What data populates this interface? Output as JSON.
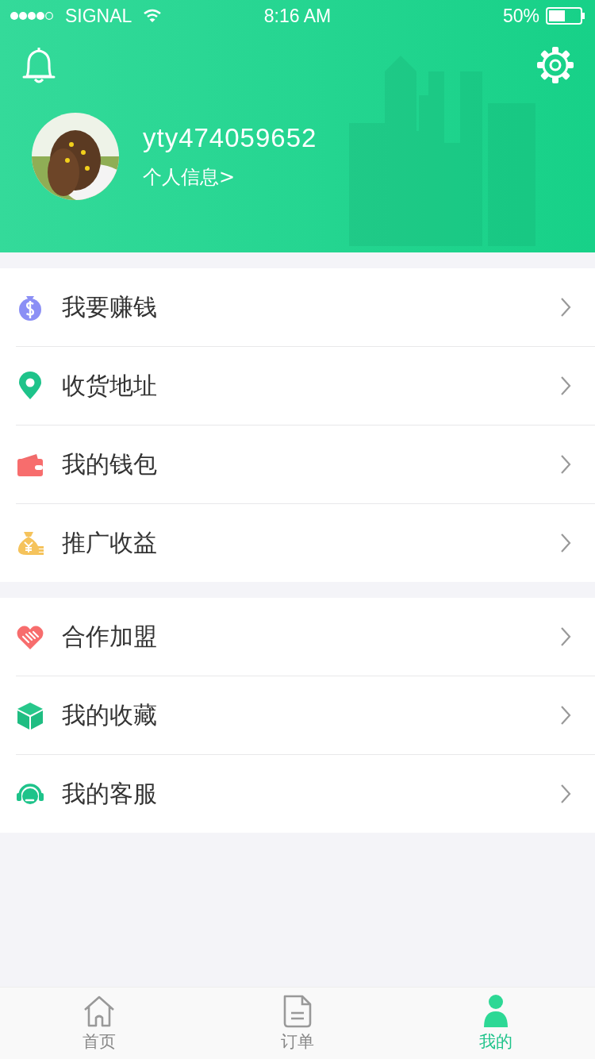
{
  "status_bar": {
    "carrier": "SIGNAL",
    "time": "8:16 AM",
    "battery": "50%"
  },
  "profile": {
    "username": "yty474059652",
    "link": "个人信息>"
  },
  "menu_groups": [
    {
      "items": [
        {
          "kind": "money",
          "label": "我要赚钱"
        },
        {
          "kind": "pin",
          "label": "收货地址"
        },
        {
          "kind": "wallet",
          "label": "我的钱包"
        },
        {
          "kind": "yen",
          "label": "推广收益"
        }
      ]
    },
    {
      "items": [
        {
          "kind": "handshake",
          "label": "合作加盟"
        },
        {
          "kind": "cube",
          "label": "我的收藏"
        },
        {
          "kind": "headset",
          "label": "我的客服"
        }
      ]
    }
  ],
  "tab_bar": [
    {
      "kind": "home",
      "label": "首页",
      "selected": false
    },
    {
      "kind": "order",
      "label": "订单",
      "selected": false
    },
    {
      "kind": "me",
      "label": "我的",
      "selected": true
    }
  ]
}
